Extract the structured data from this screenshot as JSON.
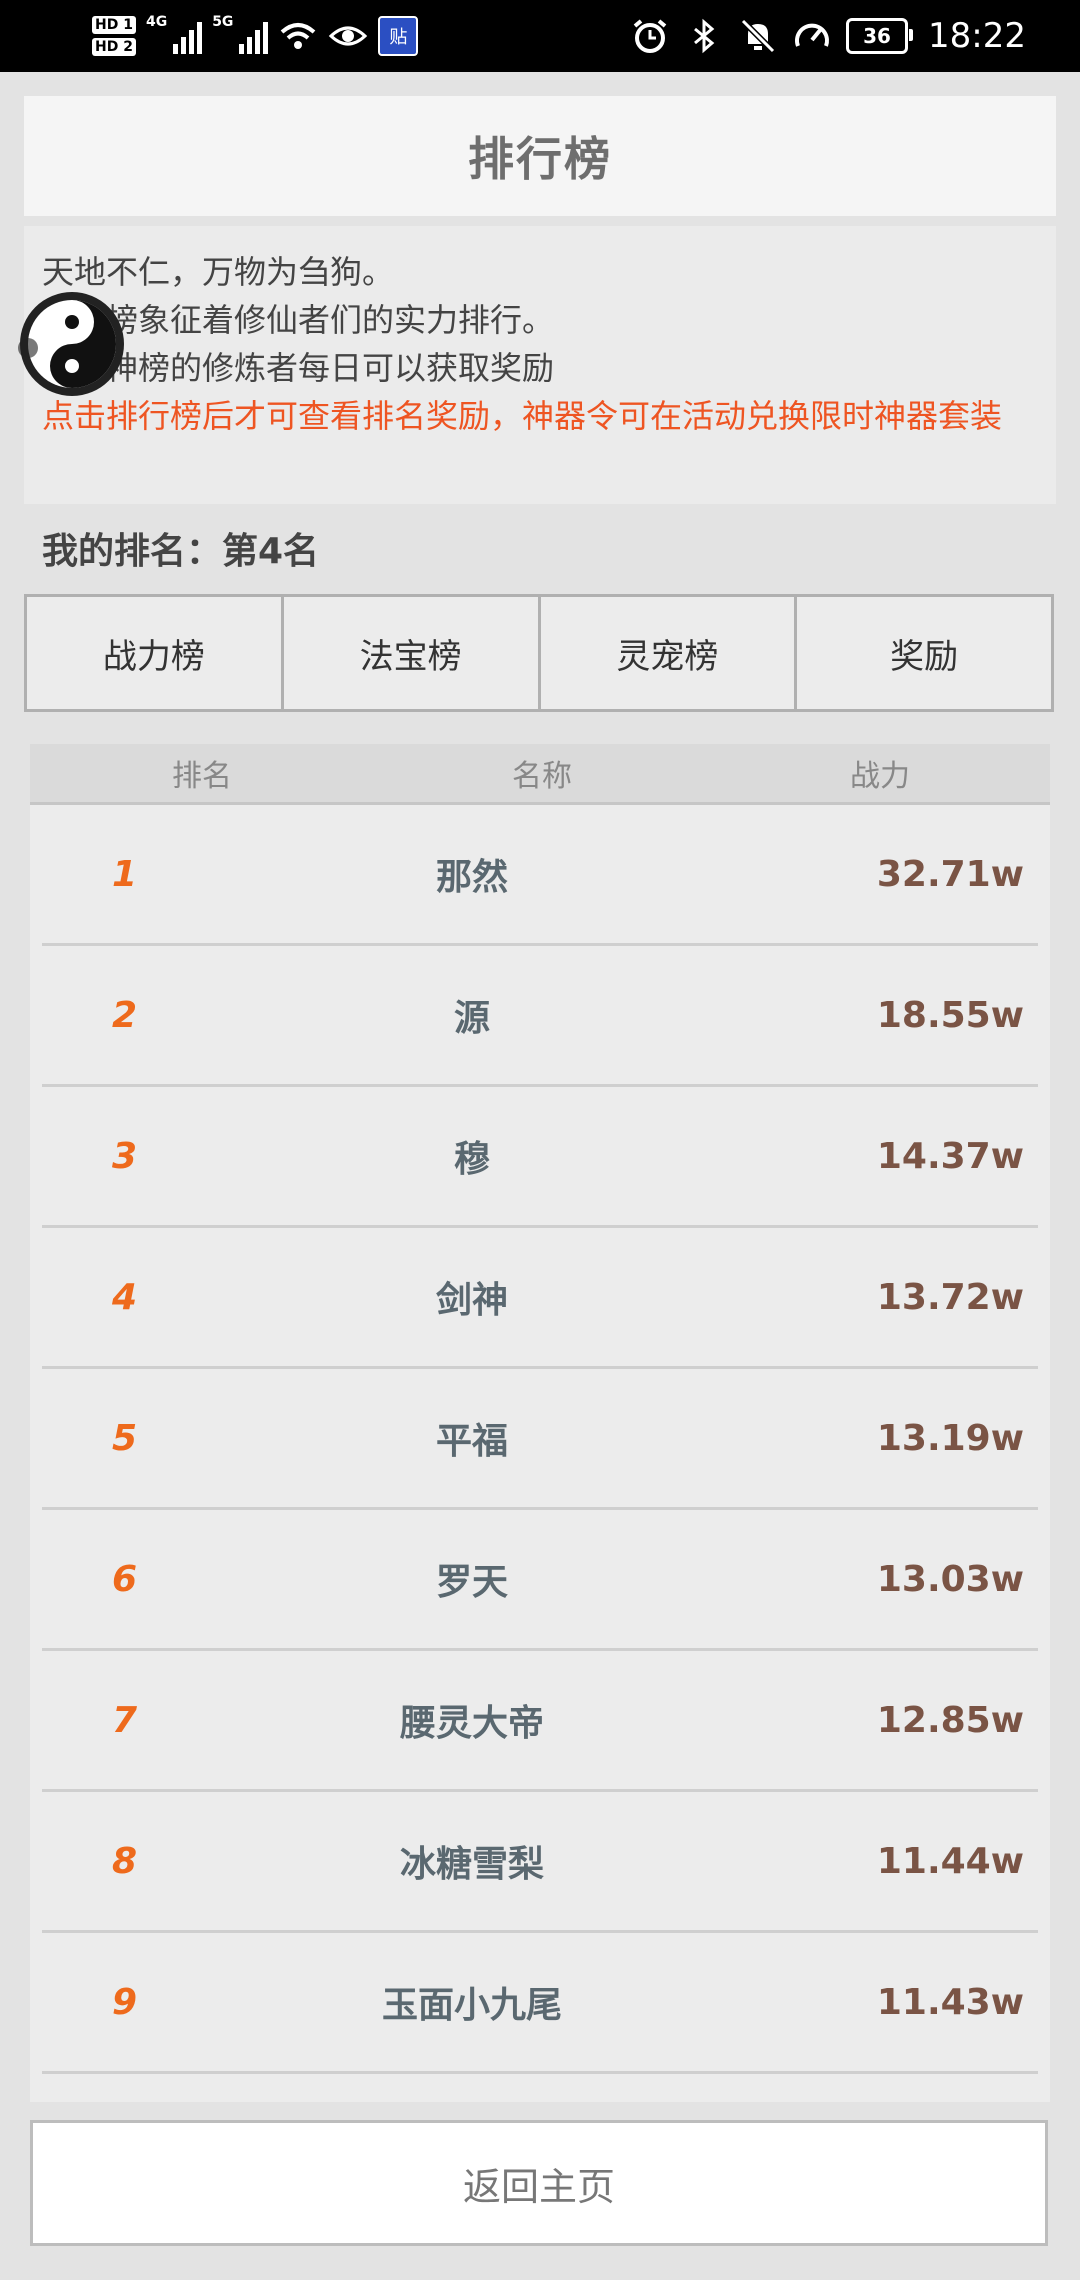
{
  "status_bar": {
    "hd1": "HD 1",
    "hd2": "HD 2",
    "net1": "4G",
    "net2": "5G",
    "app_badge": "贴",
    "battery": "36",
    "time": "18:22"
  },
  "header": {
    "title": "排行榜"
  },
  "description": {
    "line1": "天地不仁，万物为刍狗。",
    "line2": "　　榜象征着修仙者们的实力排行。",
    "line3": "　　神榜的修炼者每日可以获取奖励",
    "notice": "点击排行榜后才可查看排名奖励，神器令可在活动兑换限时神器套装"
  },
  "my_rank": "我的排名：第4名",
  "tabs": [
    {
      "label": "战力榜"
    },
    {
      "label": "法宝榜"
    },
    {
      "label": "灵宠榜"
    },
    {
      "label": "奖励"
    }
  ],
  "table": {
    "headers": {
      "rank": "排名",
      "name": "名称",
      "power": "战力"
    },
    "rows": [
      {
        "rank": "1",
        "name": "那然",
        "power": "32.71w"
      },
      {
        "rank": "2",
        "name": "源",
        "power": "18.55w"
      },
      {
        "rank": "3",
        "name": "穆",
        "power": "14.37w"
      },
      {
        "rank": "4",
        "name": "剑神",
        "power": "13.72w"
      },
      {
        "rank": "5",
        "name": "平福",
        "power": "13.19w"
      },
      {
        "rank": "6",
        "name": "罗天",
        "power": "13.03w"
      },
      {
        "rank": "7",
        "name": "腰灵大帝",
        "power": "12.85w"
      },
      {
        "rank": "8",
        "name": "冰糖雪梨",
        "power": "11.44w"
      },
      {
        "rank": "9",
        "name": "玉面小九尾",
        "power": "11.43w"
      }
    ]
  },
  "footer": {
    "home_button": "返回主页"
  },
  "colors": {
    "rank_accent": "#ee6a1c",
    "notice_red": "#ee5522",
    "name_text": "#5a6870",
    "power_text": "#7a5445"
  }
}
